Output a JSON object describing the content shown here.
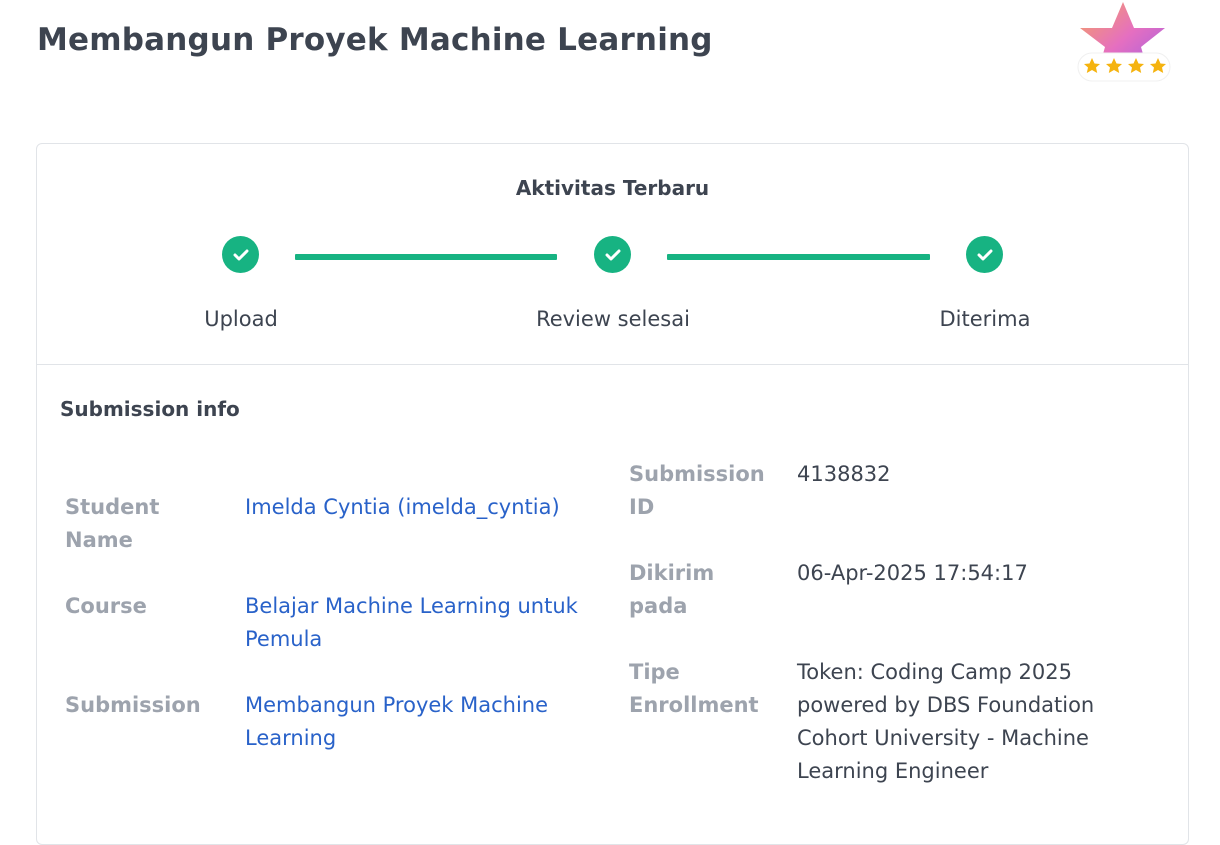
{
  "page": {
    "title": "Membangun Proyek Machine Learning"
  },
  "badge": {
    "icon": "star-rating-badge-icon",
    "rating_stars": 4
  },
  "activity": {
    "title": "Aktivitas Terbaru",
    "steps": [
      {
        "label": "Upload",
        "status": "complete"
      },
      {
        "label": "Review selesai",
        "status": "complete"
      },
      {
        "label": "Diterima",
        "status": "complete"
      }
    ],
    "accent_color": "#17b382"
  },
  "submission_info": {
    "title": "Submission info",
    "student_name": {
      "label": "Student Name",
      "value": "Imelda Cyntia (imelda_cyntia)"
    },
    "course": {
      "label": "Course",
      "value": "Belajar Machine Learning untuk Pemula"
    },
    "submission": {
      "label": "Submission",
      "value": "Membangun Proyek Machine Learning"
    },
    "submission_id": {
      "label": "Submission ID",
      "value": "4138832"
    },
    "submitted_at": {
      "label": "Dikirim pada",
      "value": "06-Apr-2025 17:54:17"
    },
    "enrollment_type": {
      "label": "Tipe Enrollment",
      "value": "Token: Coding Camp 2025 powered by DBS Foundation Cohort University - Machine Learning Engineer"
    }
  },
  "colors": {
    "link": "#2962c9",
    "label": "#9da3ad",
    "text": "#3d4450"
  }
}
